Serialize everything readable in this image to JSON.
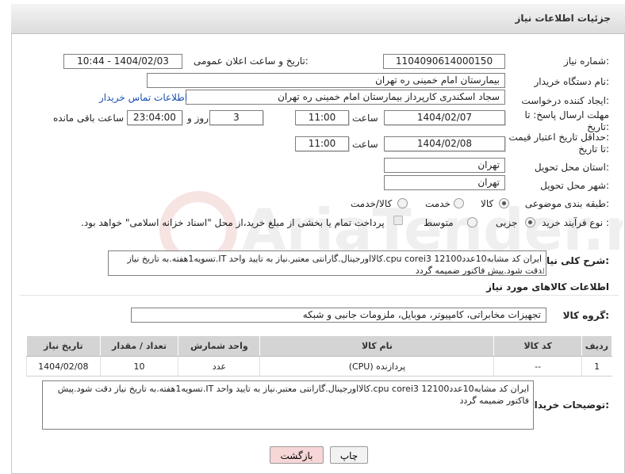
{
  "header": {
    "title": "جزئیات اطلاعات نیاز"
  },
  "fields": {
    "need_number_label": "شماره نیاز:",
    "need_number": "1104090614000150",
    "announce_label": "تاریخ و ساعت اعلان عمومی:",
    "announce_value": "1404/02/03 - 10:44",
    "buyer_org_label": "نام دستگاه خریدار:",
    "buyer_org": "بیمارستان امام خمینی ره  تهران",
    "creator_label": "ایجاد کننده درخواست:",
    "creator": "سجاد اسکندری کارپرداز بیمارستان امام خمینی ره  تهران",
    "buyer_contact_link": "اطلاعات تماس خریدار",
    "deadline_label_1": "مهلت ارسال پاسخ: تا",
    "deadline_label_2": "تاریخ:",
    "deadline_date": "1404/02/07",
    "time_label": "ساعت",
    "deadline_time": "11:00",
    "days_value": "3",
    "days_label": "روز و",
    "remaining_time": "23:04:00",
    "remaining_label": "ساعت باقی مانده",
    "min_price_label_1": "حداقل تاریخ اعتبار قیمت:",
    "min_price_label_2": "تا تاریخ:",
    "min_price_date": "1404/02/08",
    "min_price_time": "11:00",
    "province_label": "استان محل تحویل:",
    "province": "تهران",
    "city_label": "شهر محل تحویل:",
    "city": "تهران",
    "category_label": "طبقه بندی موضوعی:",
    "category_options": [
      "کالا",
      "خدمت",
      "کالا/خدمت"
    ],
    "category_selected": "کالا",
    "process_label": "نوع فرآیند خرید :",
    "process_options": [
      "جزیی",
      "متوسط"
    ],
    "process_selected": "جزیی",
    "payment_note": "پرداخت تمام یا بخشی از مبلغ خرید،از محل \"اسناد خزانه اسلامی\" خواهد بود.",
    "general_desc_label": "شرح کلی نیاز:",
    "general_desc": "ایران کد مشابه10عددcpu corei3 12100.کالااورجینال.گارانتی معتبر.نیاز به تایید واحد IT.تسویه1هفته.به تاریخ نیاز دقت شود.پیش فاکتور ضمیمه گردد"
  },
  "goods_section": {
    "title": "اطلاعات کالاهای مورد نیاز",
    "group_label": "گروه کالا:",
    "group_value": "تجهیزات مخابراتی، کامپیوتر، موبایل، ملزومات جانبی و شبکه"
  },
  "table": {
    "headers": [
      "ردیف",
      "کد کالا",
      "نام کالا",
      "واحد شمارش",
      "تعداد / مقدار",
      "تاریخ نیاز"
    ],
    "rows": [
      [
        "1",
        "--",
        "پردازنده (CPU)",
        "عدد",
        "10",
        "1404/02/08"
      ]
    ]
  },
  "buyer_notes": {
    "label": "توضیحات خریدار:",
    "text": "ایران کد مشابه10عددcpu corei3 12100.کالااورجینال.گارانتی معتبر.نیاز به تایید واحد IT.تسویه1هفته.به تاریخ نیاز دقت شود.پیش فاکتور ضمیمه گردد"
  },
  "buttons": {
    "print": "چاپ",
    "back": "بازگشت"
  },
  "watermark": {
    "text": "AriaTender.neT"
  },
  "colors": {
    "link": "#1a4fb0",
    "back_button": "#f6d6d6",
    "header_bg": "#e2e2e2"
  }
}
